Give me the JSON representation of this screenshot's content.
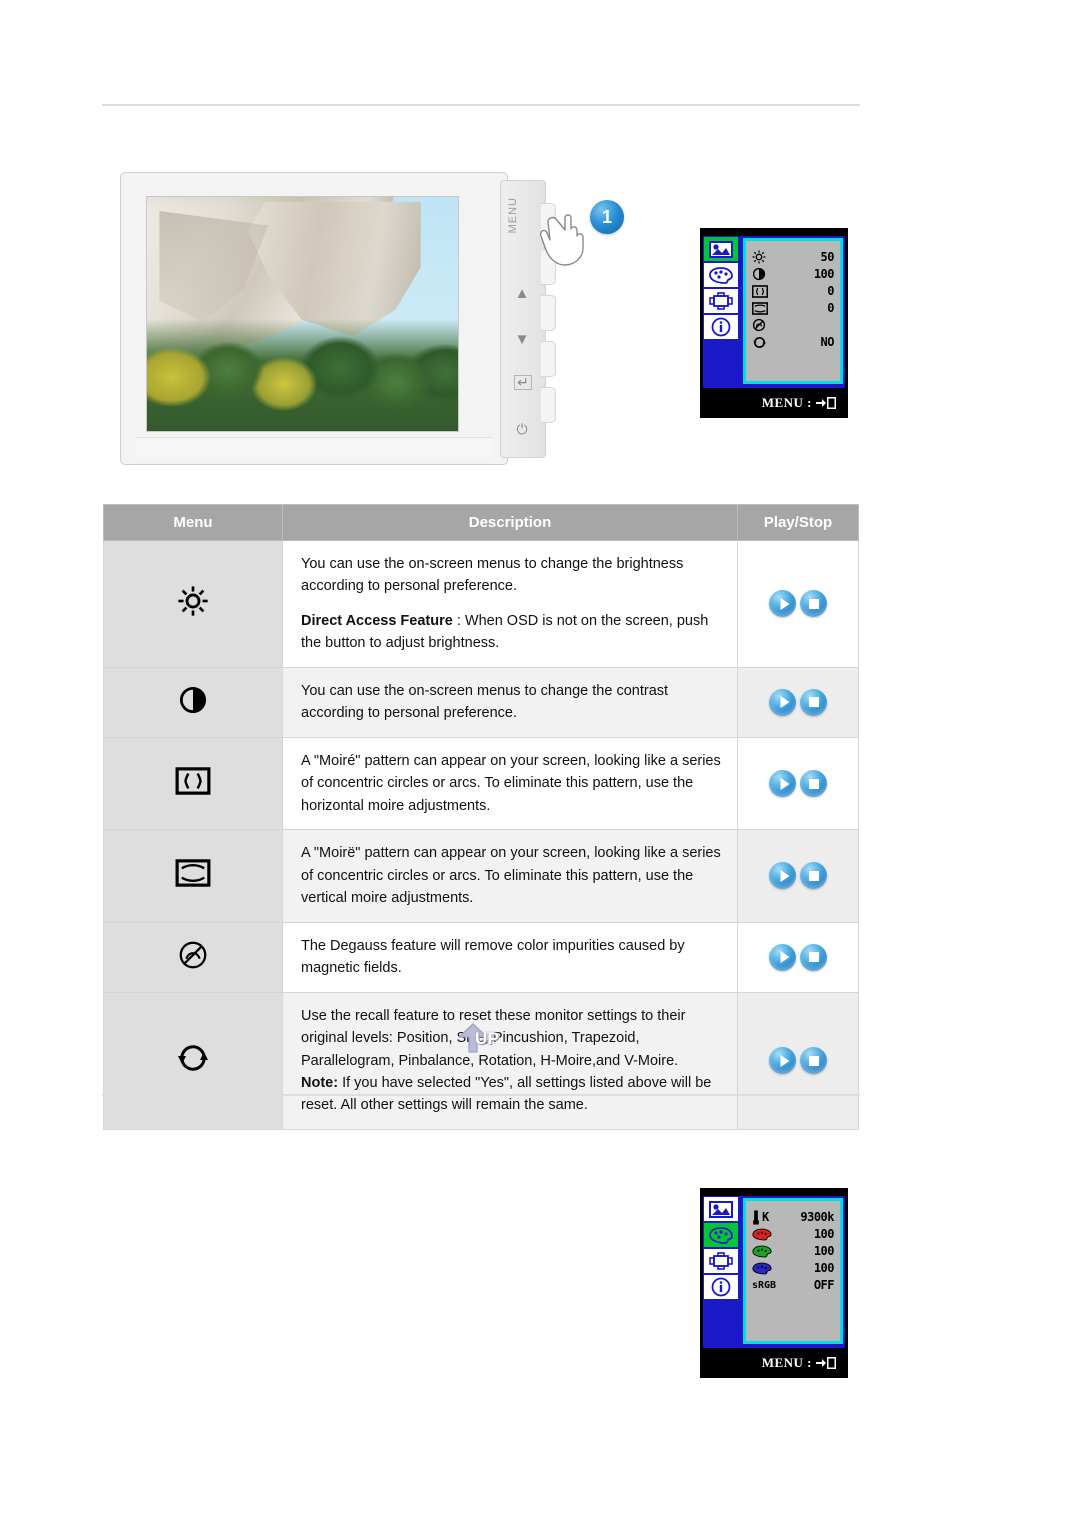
{
  "page": {
    "rule_top": "horizontal-divider",
    "rule_bottom": "horizontal-divider"
  },
  "monitor_figure": {
    "callout_number": "1",
    "panel_labels": {
      "menu": "MENU",
      "up": "▲",
      "down": "▼",
      "enter": "↵",
      "power": "⏻"
    },
    "screen_alt": "photograph of a granite rock cliff above autumn trees with blue sky"
  },
  "osd_top": {
    "sidebar": [
      {
        "name": "picture-tab",
        "glyph": "picture",
        "active": true
      },
      {
        "name": "color-tab",
        "glyph": "palette",
        "active": false
      },
      {
        "name": "geometry-tab",
        "glyph": "geometry",
        "active": false
      },
      {
        "name": "information-tab",
        "glyph": "info",
        "active": false
      }
    ],
    "rows": [
      {
        "icon": "brightness",
        "value": "50"
      },
      {
        "icon": "contrast",
        "value": "100"
      },
      {
        "icon": "h-moire",
        "value": "0"
      },
      {
        "icon": "v-moire",
        "value": "0"
      },
      {
        "icon": "degauss",
        "value": ""
      },
      {
        "icon": "recall",
        "value": "NO"
      }
    ],
    "footer": "MENU :"
  },
  "osd_bottom": {
    "sidebar": [
      {
        "name": "picture-tab",
        "glyph": "picture",
        "active": false
      },
      {
        "name": "color-tab",
        "glyph": "palette",
        "active": true
      },
      {
        "name": "geometry-tab",
        "glyph": "geometry",
        "active": false
      },
      {
        "name": "information-tab",
        "glyph": "info",
        "active": false
      }
    ],
    "rows": [
      {
        "icon": "color-temperature",
        "label": "K",
        "value": "9300k"
      },
      {
        "icon": "red-palette",
        "label": "",
        "value": "100"
      },
      {
        "icon": "green-palette",
        "label": "",
        "value": "100"
      },
      {
        "icon": "blue-palette",
        "label": "",
        "value": "100"
      },
      {
        "icon": "srgb",
        "label": "sRGB",
        "value": "OFF"
      }
    ],
    "footer": "MENU :"
  },
  "table": {
    "headers": {
      "menu": "Menu",
      "description": "Description",
      "play_stop": "Play/Stop"
    },
    "rows": [
      {
        "icon": "brightness-icon",
        "icon_glyph": "☼",
        "paragraphs": [
          {
            "text": "You can use the on-screen menus to change the brightness according to personal preference."
          },
          {
            "bold": "Direct Access Feature",
            "text": " : When OSD is not on the screen, push the button to adjust brightness."
          }
        ],
        "play_label": "Play",
        "stop_label": "Stop"
      },
      {
        "icon": "contrast-icon",
        "icon_glyph": "◐",
        "paragraphs": [
          {
            "text": "You can use the on-screen menus to change the contrast according to personal preference."
          }
        ],
        "play_label": "Play",
        "stop_label": "Stop"
      },
      {
        "icon": "horizontal-moire-icon",
        "icon_glyph": "⎸",
        "paragraphs": [
          {
            "text": "A \"Moiré\" pattern can appear on your screen, looking like a series of concentric circles or arcs. To eliminate this pattern, use the horizontal moire adjustments."
          }
        ],
        "play_label": "Play",
        "stop_label": "Stop"
      },
      {
        "icon": "vertical-moire-icon",
        "icon_glyph": "⎹",
        "paragraphs": [
          {
            "text": "A \"Moirë\" pattern can appear on your screen, looking like a series of concentric circles or arcs. To eliminate this pattern, use the vertical moire adjustments."
          }
        ],
        "play_label": "Play",
        "stop_label": "Stop"
      },
      {
        "icon": "degauss-icon",
        "icon_glyph": "⊗",
        "paragraphs": [
          {
            "text": "The Degauss feature will remove color impurities caused by magnetic fields."
          }
        ],
        "play_label": "Play",
        "stop_label": "Stop"
      },
      {
        "icon": "recall-icon",
        "icon_glyph": "↺",
        "paragraphs": [
          {
            "text": "Use the recall feature to reset these monitor settings to their original levels: Position, Size, Pincushion, Trapezoid, Parallelogram, Pinbalance, Rotation, H-Moire,and V-Moire."
          },
          {
            "bold": "Note:",
            "text": " If you have selected \"Yes\", all settings listed above will be reset. All other settings will remain the same."
          }
        ],
        "play_label": "Play",
        "stop_label": "Stop"
      }
    ]
  },
  "up_button": {
    "label": "UP"
  },
  "colors": {
    "header_bg": "#a6a6a6",
    "menu_cell_bg": "#dedede",
    "alt_row_bg": "#f2f2f2",
    "osd_blue": "#1a18c8",
    "osd_cyan": "#00dede",
    "osd_active_green": "#00c832",
    "button_blue": "#2a8bd0",
    "callout_blue": "#2a8fd4"
  }
}
